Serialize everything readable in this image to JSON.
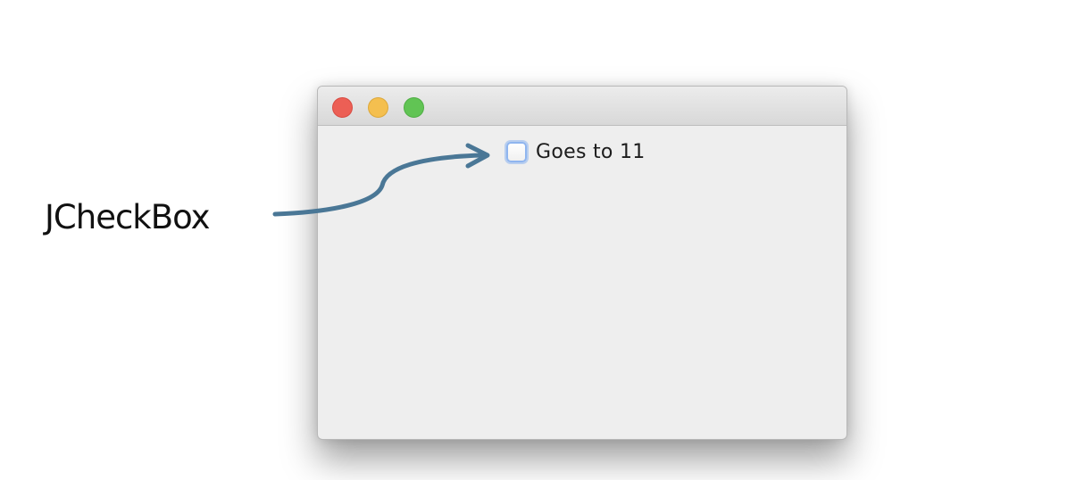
{
  "annotation": {
    "label": "JCheckBox",
    "arrow_color": "#4a7796"
  },
  "window": {
    "title": "",
    "controls": {
      "close_icon": "close-icon",
      "minimize_icon": "minimize-icon",
      "zoom_icon": "zoom-icon"
    },
    "checkbox": {
      "label": "Goes to 11",
      "checked": false,
      "focus_ring_color": "#8fb5ef"
    }
  }
}
